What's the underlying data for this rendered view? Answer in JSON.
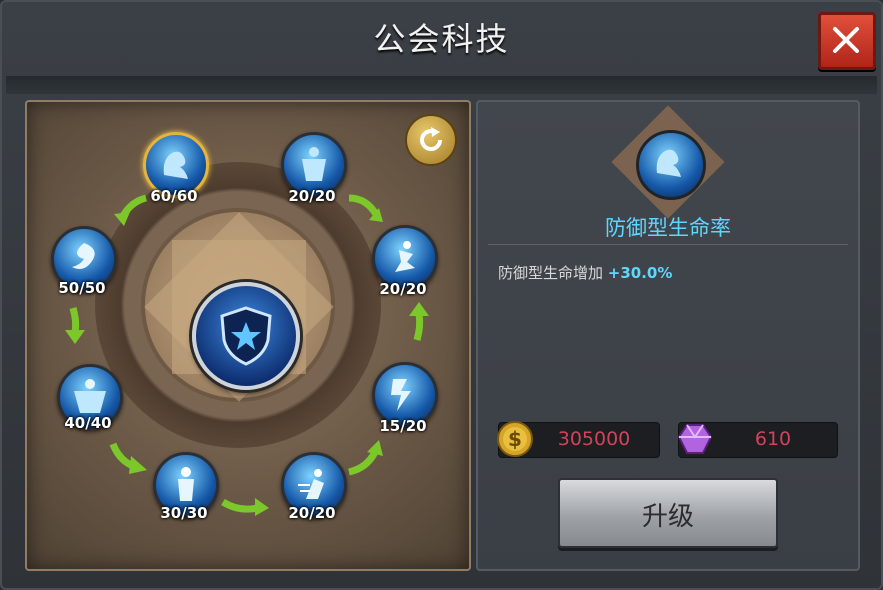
{
  "window": {
    "title": "公会科技",
    "close_icon": "close-icon"
  },
  "tech_tree": {
    "refresh_icon": "refresh-icon",
    "center_icon": "shield-star-icon",
    "nodes": [
      {
        "id": "defense-hp-rate",
        "icon": "flexed-arm-icon",
        "progress": "60/60",
        "active": true
      },
      {
        "id": "body-armor",
        "icon": "armored-figure-icon",
        "progress": "20/20",
        "active": false
      },
      {
        "id": "surf-attack",
        "icon": "surfer-icon",
        "progress": "20/20",
        "active": false
      },
      {
        "id": "lightning-kick",
        "icon": "lightning-kick-icon",
        "progress": "15/20",
        "active": false
      },
      {
        "id": "dash-strike",
        "icon": "dash-strike-icon",
        "progress": "20/20",
        "active": false
      },
      {
        "id": "speed-runner",
        "icon": "runner-icon",
        "progress": "30/30",
        "active": false
      },
      {
        "id": "muscle-body",
        "icon": "muscle-icon",
        "progress": "40/40",
        "active": false
      },
      {
        "id": "whirlwind",
        "icon": "whirlwind-icon",
        "progress": "50/50",
        "active": false
      }
    ]
  },
  "detail": {
    "icon": "flexed-arm-icon",
    "name": "防御型生命率",
    "desc_prefix": "防御型生命增加 ",
    "desc_value": "+30.0%",
    "costs": {
      "gold": "305000",
      "gold_icon": "gold-coin-icon",
      "gem": "610",
      "gem_icon": "purple-gem-icon"
    },
    "upgrade_label": "升级"
  },
  "colors": {
    "accent_cyan": "#5fd6ff",
    "cost_red": "#d2435a",
    "active_gold": "#e6b43a"
  }
}
